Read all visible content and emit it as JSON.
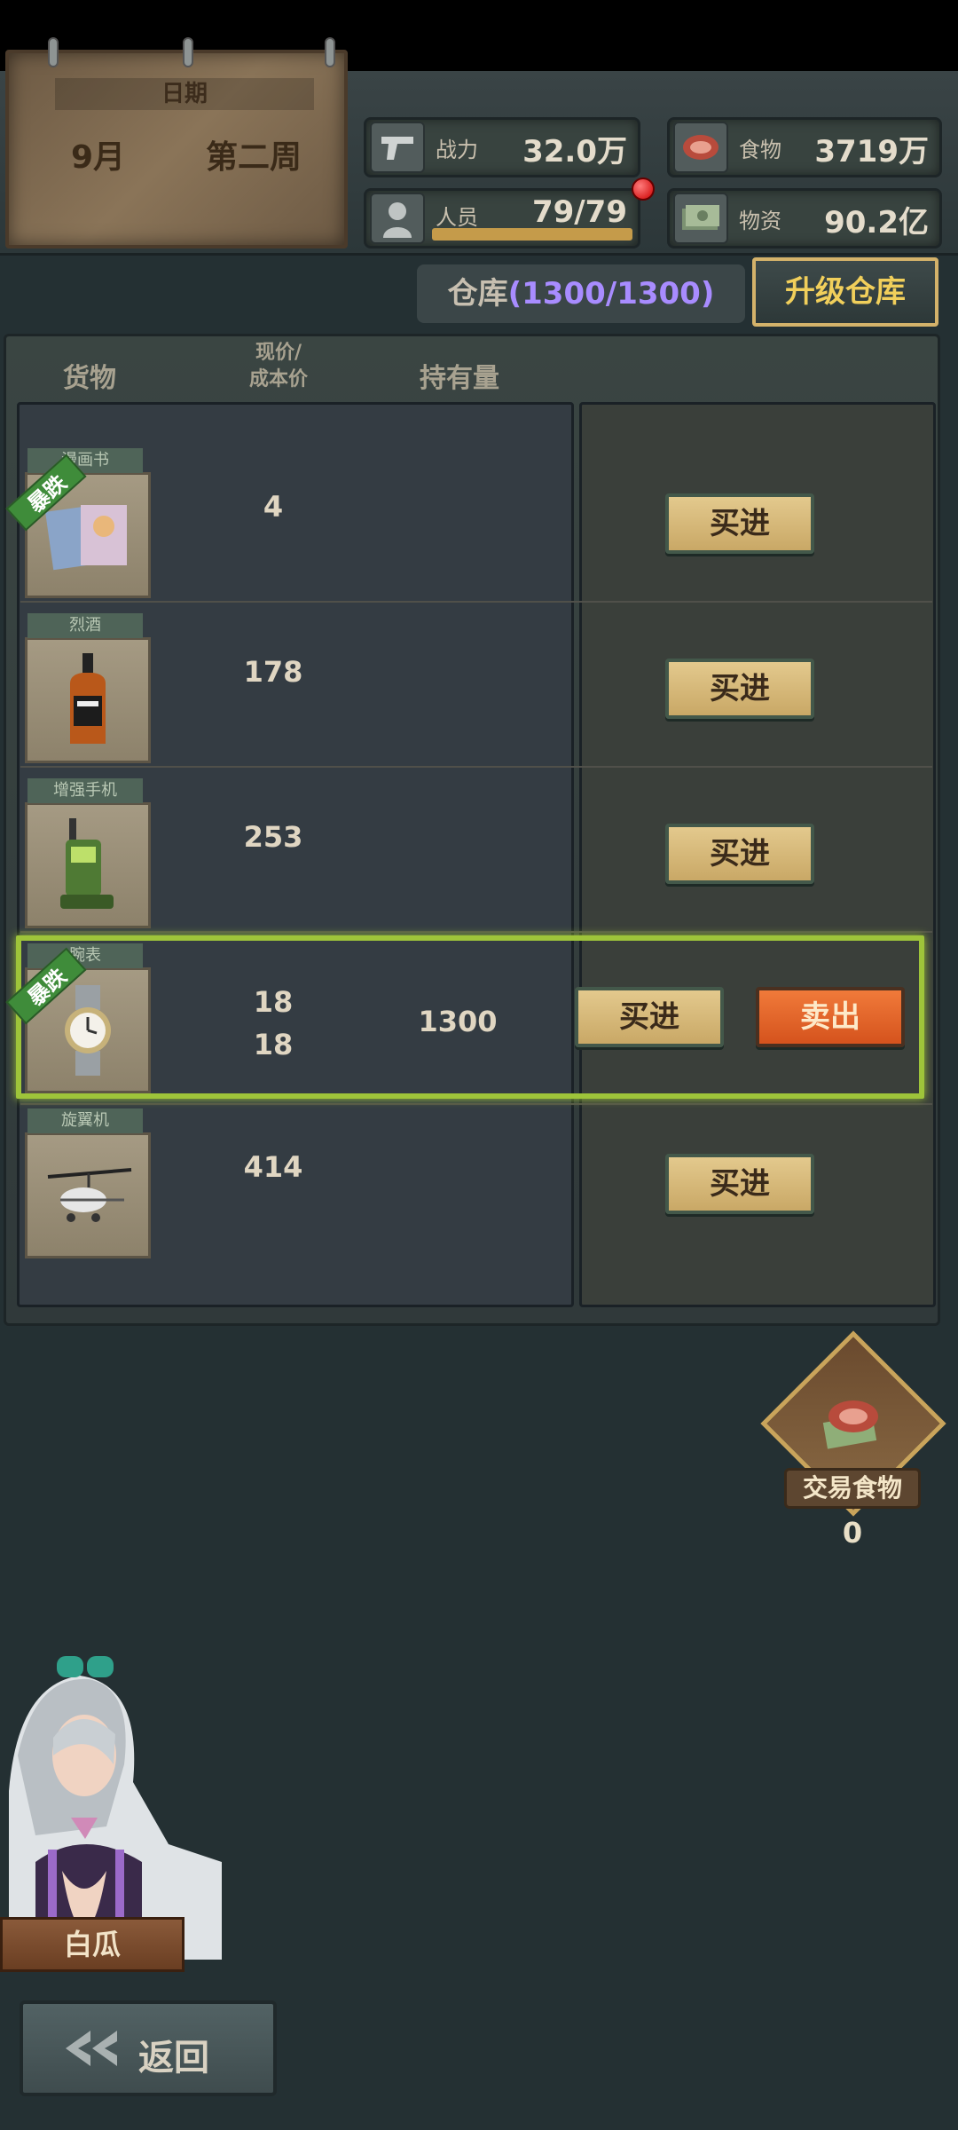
{
  "date": {
    "label": "日期",
    "month": "9月",
    "week": "第二周"
  },
  "stats": {
    "power": {
      "label": "战力",
      "value": "32.0万",
      "icon": "pistol-icon"
    },
    "personnel": {
      "label": "人员",
      "value": "79/79",
      "icon": "person-icon"
    },
    "food": {
      "label": "食物",
      "value": "3719万",
      "icon": "meat-icon"
    },
    "supplies": {
      "label": "物资",
      "value": "90.2亿",
      "icon": "cash-icon"
    }
  },
  "warehouse": {
    "label": "仓库",
    "capacity": "(1300/1300)",
    "upgrade_label": "升级仓库"
  },
  "columns": {
    "goods": "货物",
    "price_top": "现价/",
    "price_bottom": "成本价",
    "holding": "持有量"
  },
  "goods": [
    {
      "name": "漫画书",
      "icon": "comic-book-icon",
      "price": "4",
      "crash": "暴跌",
      "buy": "买进"
    },
    {
      "name": "烈酒",
      "icon": "whiskey-bottle-icon",
      "price": "178",
      "buy": "买进"
    },
    {
      "name": "增强手机",
      "icon": "walkie-talkie-icon",
      "price": "253",
      "buy": "买进"
    },
    {
      "name": "腕表",
      "icon": "wristwatch-icon",
      "price": "18",
      "cost": "18",
      "holding": "1300",
      "crash": "暴跌",
      "buy": "买进",
      "sell": "卖出"
    },
    {
      "name": "旋翼机",
      "icon": "gyrocopter-icon",
      "price": "414",
      "buy": "买进"
    }
  ],
  "trade_food": {
    "label": "交易食物",
    "count": "0"
  },
  "character": {
    "name": "白瓜"
  },
  "back": {
    "label": "返回"
  }
}
